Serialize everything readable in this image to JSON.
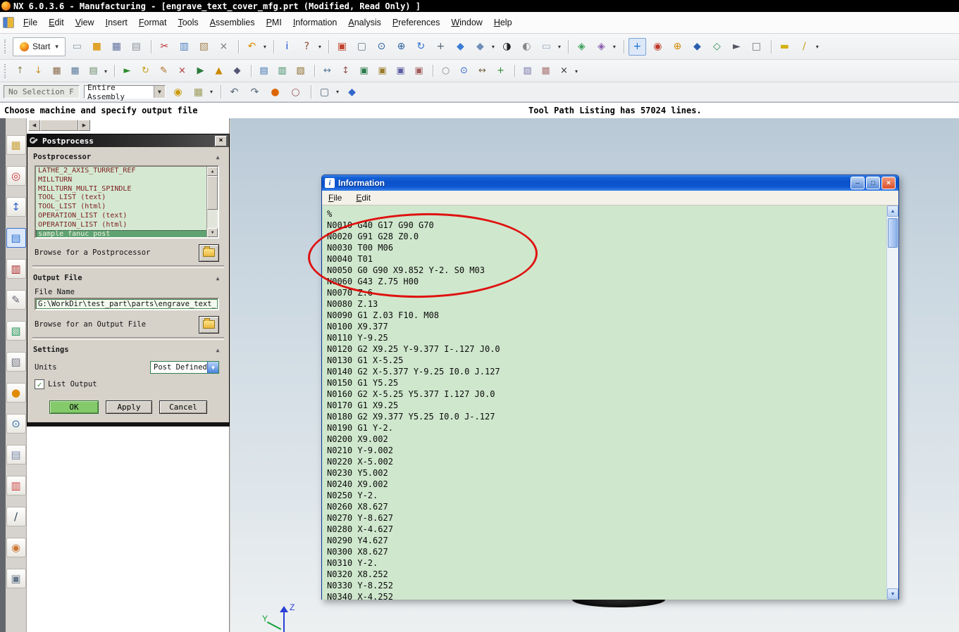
{
  "colors": {
    "info_bg": "#cfe7cd",
    "accent_green": "#84c96a",
    "selection_green": "#5fa372",
    "annotation_red": "#e10000",
    "list_text": "#7b1d1d"
  },
  "window": {
    "title": "NX 6.0.3.6 - Manufacturing - [engrave_text_cover_mfg.prt (Modified, Read Only) ]"
  },
  "menubar": {
    "items": [
      "File",
      "Edit",
      "View",
      "Insert",
      "Format",
      "Tools",
      "Assemblies",
      "PMI",
      "Information",
      "Analysis",
      "Preferences",
      "Window",
      "Help"
    ]
  },
  "toolbar1": {
    "start_label": "Start",
    "icons": [
      {
        "name": "new-part-icon",
        "glyph": "▭",
        "color": "#8a98a6"
      },
      {
        "name": "open-icon",
        "glyph": "■",
        "color": "#e0a32e"
      },
      {
        "name": "save-icon",
        "glyph": "▦",
        "color": "#5f6f9e"
      },
      {
        "name": "print-icon",
        "glyph": "▤",
        "color": "#8b939b"
      },
      {
        "name": "cut-icon",
        "glyph": "✂",
        "color": "#bb3333",
        "gap": true
      },
      {
        "name": "copy-icon",
        "glyph": "▥",
        "color": "#4a7fc1"
      },
      {
        "name": "paste-icon",
        "glyph": "▧",
        "color": "#a9885a"
      },
      {
        "name": "delete-icon",
        "glyph": "×",
        "color": "#777777"
      },
      {
        "name": "undo-icon",
        "glyph": "↶",
        "color": "#e08a00",
        "dd": true,
        "gap": true
      },
      {
        "name": "information-pick-icon",
        "glyph": "i",
        "color": "#1a4fd1",
        "gap": true
      },
      {
        "name": "user-tools-icon",
        "glyph": "?",
        "color": "#8a4a2a",
        "dd": true
      },
      {
        "name": "refresh-view-icon",
        "glyph": "▣",
        "color": "#c24430",
        "gap": true
      },
      {
        "name": "fit-view-icon",
        "glyph": "▢",
        "color": "#667788"
      },
      {
        "name": "zoom-window-icon",
        "glyph": "⊙",
        "color": "#2a5f9e"
      },
      {
        "name": "zoom-in-out-icon",
        "glyph": "⊕",
        "color": "#2a5f9e"
      },
      {
        "name": "rotate-view-icon",
        "glyph": "↻",
        "color": "#2a6fd6"
      },
      {
        "name": "pan-view-icon",
        "glyph": "+",
        "color": "#556677"
      },
      {
        "name": "shaded-display-icon",
        "glyph": "◆",
        "color": "#3a7bd5"
      },
      {
        "name": "display-mode-icon",
        "glyph": "◆",
        "color": "#6f8fb8",
        "dd": true
      },
      {
        "name": "edit-object-display-icon",
        "glyph": "◑",
        "color": "#222222"
      },
      {
        "name": "face-analysis-icon",
        "glyph": "◐",
        "color": "#888888"
      },
      {
        "name": "background-icon",
        "glyph": "▭",
        "color": "#99aabb",
        "dd": true
      },
      {
        "name": "arrange-windows-icon",
        "glyph": "◈",
        "color": "#3aa05a",
        "gap": true
      },
      {
        "name": "new-window-icon",
        "glyph": "◈",
        "color": "#8a5ab0",
        "dd": true
      },
      {
        "name": "orient-wcs-icon",
        "glyph": "+",
        "color": "#1a6fd4",
        "active": true,
        "gap": true
      },
      {
        "name": "snap-point-icon",
        "glyph": "◉",
        "color": "#c03a2a"
      },
      {
        "name": "point-constructor-icon",
        "glyph": "⊕",
        "color": "#d08a00"
      },
      {
        "name": "snap-endpoint-icon",
        "glyph": "◆",
        "color": "#2a5fae"
      },
      {
        "name": "snap-midpoint-icon",
        "glyph": "◇",
        "color": "#2a8a4e"
      },
      {
        "name": "selection-cursor-icon",
        "glyph": "►",
        "color": "#555566"
      },
      {
        "name": "quick-pick-icon",
        "glyph": "□",
        "color": "#777777"
      },
      {
        "name": "measure-distance-icon",
        "glyph": "▬",
        "color": "#d4b014",
        "gap": true
      },
      {
        "name": "annotation-pen-icon",
        "glyph": "/",
        "color": "#caa020",
        "dd": true
      }
    ]
  },
  "toolbar2": {
    "icons": [
      {
        "name": "show-2d-path-icon",
        "glyph": "↑",
        "color": "#8a8a55"
      },
      {
        "name": "show-3d-path-icon",
        "glyph": "↓",
        "color": "#c89020"
      },
      {
        "name": "machine-tool-builder-icon",
        "glyph": "▦",
        "color": "#8a6a4a"
      },
      {
        "name": "machine-library-icon",
        "glyph": "▦",
        "color": "#5a7a9a"
      },
      {
        "name": "exit-environment-icon",
        "glyph": "▤",
        "color": "#6a8a6a",
        "dd": true
      },
      {
        "name": "generate-toolpath-icon",
        "glyph": "►",
        "color": "#2a8a2a",
        "gap": true
      },
      {
        "name": "replay-toolpath-icon",
        "glyph": "↻",
        "color": "#c9a020"
      },
      {
        "name": "edit-toolpath-icon",
        "glyph": "✎",
        "color": "#b06a20"
      },
      {
        "name": "delete-toolpath-icon",
        "glyph": "×",
        "color": "#aa3333"
      },
      {
        "name": "verify-toolpath-icon",
        "glyph": "▶",
        "color": "#2a7a3a"
      },
      {
        "name": "gouge-check-icon",
        "glyph": "▲",
        "color": "#cc8800"
      },
      {
        "name": "lock-toolpath-icon",
        "glyph": "◆",
        "color": "#555577"
      },
      {
        "name": "list-toolpath-icon",
        "glyph": "▤",
        "color": "#3a6fae",
        "gap": true
      },
      {
        "name": "postprocess-icon",
        "glyph": "▥",
        "color": "#3a8a5e"
      },
      {
        "name": "shop-documentation-icon",
        "glyph": "▧",
        "color": "#8a6a2a"
      },
      {
        "name": "transform-paths-icon",
        "glyph": "↔",
        "color": "#557799",
        "gap": true
      },
      {
        "name": "reorder-operations-icon",
        "glyph": "↕",
        "color": "#995555"
      },
      {
        "name": "program-view-icon",
        "glyph": "▣",
        "color": "#2a7a4a"
      },
      {
        "name": "machine-tool-view-icon",
        "glyph": "▣",
        "color": "#9a7a2a"
      },
      {
        "name": "geometry-view-icon",
        "glyph": "▣",
        "color": "#5a5aa0"
      },
      {
        "name": "method-view-icon",
        "glyph": "▣",
        "color": "#a05a5a"
      },
      {
        "name": "find-operation-icon",
        "glyph": "○",
        "color": "#888888",
        "gap": true
      },
      {
        "name": "display-tool-icon",
        "glyph": "⊙",
        "color": "#3366cc"
      },
      {
        "name": "synchronize-icon",
        "glyph": "↔",
        "color": "#776644"
      },
      {
        "name": "create-operation-icon",
        "glyph": "+",
        "color": "#2a8a2a"
      },
      {
        "name": "object-properties-icon",
        "glyph": "▨",
        "color": "#7777aa",
        "gap": true
      },
      {
        "name": "output-settings-icon",
        "glyph": "▩",
        "color": "#aa7777"
      },
      {
        "name": "delete-setup-icon",
        "glyph": "×",
        "color": "#333333",
        "dd": true
      }
    ]
  },
  "selection_bar": {
    "filter_value": "No Selection Fi",
    "scope_value": "Entire Assembly",
    "icons": [
      {
        "name": "find-component-icon",
        "glyph": "◉",
        "color": "#cc9900"
      },
      {
        "name": "selection-grid-icon",
        "glyph": "▦",
        "color": "#999955",
        "dd": true
      },
      {
        "name": "snap-undo-icon",
        "glyph": "↶",
        "color": "#556677",
        "gap": true
      },
      {
        "name": "snap-redo-icon",
        "glyph": "↷",
        "color": "#556677"
      },
      {
        "name": "snap-circle-icon",
        "glyph": "●",
        "color": "#dd6600"
      },
      {
        "name": "snap-arc-icon",
        "glyph": "○",
        "color": "#995555"
      },
      {
        "name": "marquee-select-icon",
        "glyph": "▢",
        "color": "#556677",
        "dd": true,
        "gap": true
      },
      {
        "name": "work-assembly-icon",
        "glyph": "◆",
        "color": "#3366cc"
      }
    ]
  },
  "status_bar": {
    "prompt": "Choose machine and specify output file",
    "message": "Tool Path Listing has 57024 lines."
  },
  "resource_bar": {
    "icons": [
      {
        "name": "assembly-navigator-icon",
        "glyph": "▦",
        "color": "#c9a23a"
      },
      {
        "name": "constraint-navigator-icon",
        "glyph": "◎",
        "color": "#cc3333"
      },
      {
        "name": "part-navigator-icon",
        "glyph": "↕",
        "color": "#3366cc"
      },
      {
        "name": "operation-navigator-icon",
        "glyph": "▤",
        "color": "#2a6fd4",
        "active": true
      },
      {
        "name": "machining-knowledge-icon",
        "glyph": "▥",
        "color": "#aa2222"
      },
      {
        "name": "process-studio-icon",
        "glyph": "✎",
        "color": "#666677"
      },
      {
        "name": "manufacturing-wizards-icon",
        "glyph": "▧",
        "color": "#2a9a5e"
      },
      {
        "name": "templates-icon",
        "glyph": "▨",
        "color": "#777788"
      },
      {
        "name": "roles-icon",
        "glyph": "●",
        "color": "#e08a00"
      },
      {
        "name": "history-icon",
        "glyph": "⊙",
        "color": "#2a6fae"
      },
      {
        "name": "documents-icon",
        "glyph": "▤",
        "color": "#7788aa"
      },
      {
        "name": "palettes-icon",
        "glyph": "▥",
        "color": "#cc4444"
      },
      {
        "name": "signature-icon",
        "glyph": "/",
        "color": "#334455"
      },
      {
        "name": "contacts-icon",
        "glyph": "◉",
        "color": "#cc7733"
      },
      {
        "name": "camera-icon",
        "glyph": "▣",
        "color": "#667788"
      }
    ]
  },
  "postprocess_dialog": {
    "title": "Postprocess",
    "section_postprocessor": "Postprocessor",
    "section_output_file": "Output File",
    "section_settings": "Settings",
    "postprocessor_list": [
      {
        "label": "LATHE_2_AXIS_TURRET_REF"
      },
      {
        "label": "MILLTURN"
      },
      {
        "label": "MILLTURN_MULTI_SPINDLE"
      },
      {
        "label": "TOOL_LIST (text)"
      },
      {
        "label": "TOOL_LIST (html)"
      },
      {
        "label": "OPERATION_LIST (text)"
      },
      {
        "label": "OPERATION_LIST (html)"
      },
      {
        "label": "sample fanuc post",
        "selected": true
      }
    ],
    "browse_post_label": "Browse for a Postprocessor",
    "file_name_label": "File Name",
    "file_name_value": "G:\\WorkDir\\test_part\\parts\\engrave_text_c",
    "browse_output_label": "Browse for an Output File",
    "units_label": "Units",
    "units_value": "Post Defined",
    "list_output_label": "List Output",
    "list_output_checked": true,
    "buttons": {
      "ok": "OK",
      "apply": "Apply",
      "cancel": "Cancel"
    }
  },
  "information_window": {
    "title": "Information",
    "menus": [
      "File",
      "Edit"
    ],
    "lines": [
      "%",
      "N0010 G40 G17 G90 G70",
      "N0020 G91 G28 Z0.0",
      "N0030 T00 M06",
      "N0040 T01",
      "N0050 G0 G90 X9.852 Y-2. S0 M03",
      "N0060 G43 Z.75 H00",
      "N0070 Z.6",
      "N0080 Z.13",
      "N0090 G1 Z.03 F10. M08",
      "N0100 X9.377",
      "N0110 Y-9.25",
      "N0120 G2 X9.25 Y-9.377 I-.127 J0.0",
      "N0130 G1 X-5.25",
      "N0140 G2 X-5.377 Y-9.25 I0.0 J.127",
      "N0150 G1 Y5.25",
      "N0160 G2 X-5.25 Y5.377 I.127 J0.0",
      "N0170 G1 X9.25",
      "N0180 G2 X9.377 Y5.25 I0.0 J-.127",
      "N0190 G1 Y-2.",
      "N0200 X9.002",
      "N0210 Y-9.002",
      "N0220 X-5.002",
      "N0230 Y5.002",
      "N0240 X9.002",
      "N0250 Y-2.",
      "N0260 X8.627",
      "N0270 Y-8.627",
      "N0280 X-4.627",
      "N0290 Y4.627",
      "N0300 X8.627",
      "N0310 Y-2.",
      "N0320 X8.252",
      "N0330 Y-8.252",
      "N0340 X-4.252"
    ]
  },
  "viewport": {
    "csys": {
      "z_label": "Z",
      "y_label": "Y"
    }
  }
}
